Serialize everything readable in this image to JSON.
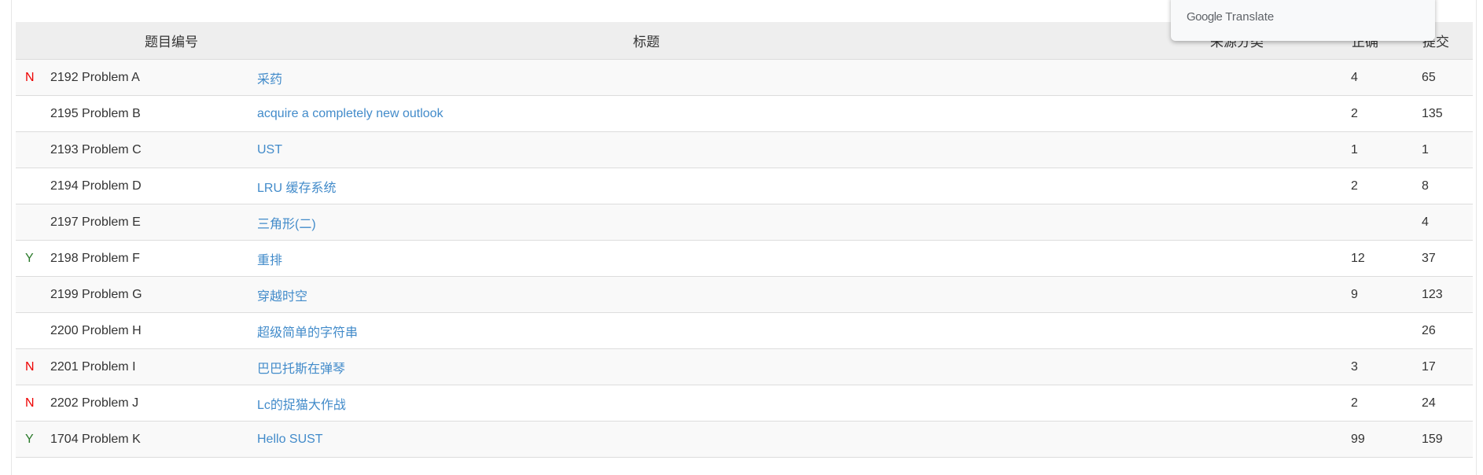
{
  "header": {
    "id": "题目编号",
    "title": "标题",
    "source": "来源分类",
    "accepted": "正确",
    "submitted": "提交"
  },
  "popup": {
    "brand": "Google",
    "product": "Translate"
  },
  "colors": {
    "link": "#428bca",
    "status_N": "#ee0000",
    "status_Y": "#2a7a2a"
  },
  "rows": [
    {
      "status": "N",
      "id": "2192 Problem  A",
      "title": "采药",
      "source": "",
      "accepted": "4",
      "submitted": "65"
    },
    {
      "status": "",
      "id": "2195 Problem  B",
      "title": "acquire a completely new outlook",
      "source": "",
      "accepted": "2",
      "submitted": "135"
    },
    {
      "status": "",
      "id": "2193 Problem  C",
      "title": "UST",
      "source": "",
      "accepted": "1",
      "submitted": "1"
    },
    {
      "status": "",
      "id": "2194 Problem  D",
      "title": "LRU 缓存系统",
      "source": "",
      "accepted": "2",
      "submitted": "8"
    },
    {
      "status": "",
      "id": "2197 Problem  E",
      "title": "三角形(二)",
      "source": "",
      "accepted": "",
      "submitted": "4"
    },
    {
      "status": "Y",
      "id": "2198 Problem  F",
      "title": "重排",
      "source": "",
      "accepted": "12",
      "submitted": "37"
    },
    {
      "status": "",
      "id": "2199 Problem  G",
      "title": "穿越时空",
      "source": "",
      "accepted": "9",
      "submitted": "123"
    },
    {
      "status": "",
      "id": "2200 Problem  H",
      "title": "超级简单的字符串",
      "source": "",
      "accepted": "",
      "submitted": "26"
    },
    {
      "status": "N",
      "id": "2201 Problem  I",
      "title": "巴巴托斯在弹琴",
      "source": "",
      "accepted": "3",
      "submitted": "17"
    },
    {
      "status": "N",
      "id": "2202 Problem  J",
      "title": "Lc的捉猫大作战",
      "source": "",
      "accepted": "2",
      "submitted": "24"
    },
    {
      "status": "Y",
      "id": "1704 Problem  K",
      "title": "Hello SUST",
      "source": "",
      "accepted": "99",
      "submitted": "159"
    }
  ]
}
